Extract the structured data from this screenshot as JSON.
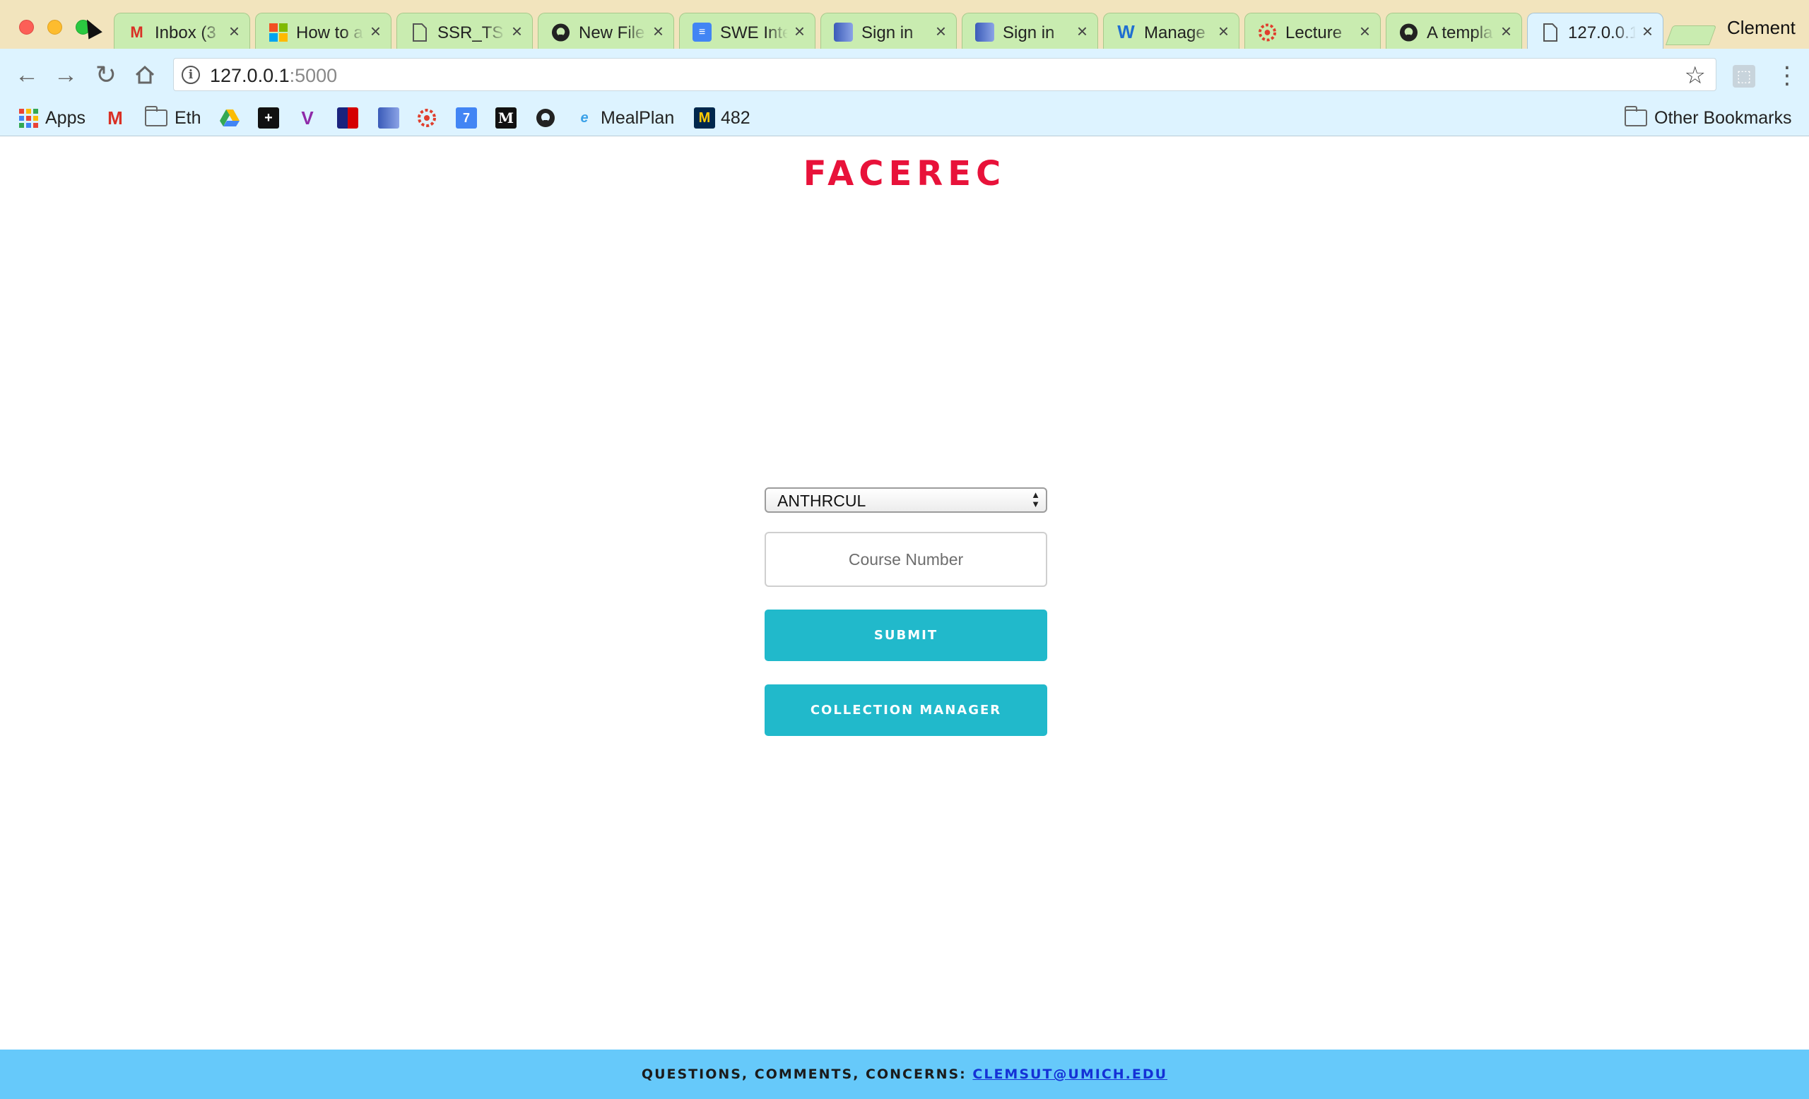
{
  "browser": {
    "profile_name": "Clement",
    "tabs": [
      {
        "title": "Inbox (3",
        "icon": "gmail-icon"
      },
      {
        "title": "How to a",
        "icon": "microsoft-icon"
      },
      {
        "title": "SSR_TSI",
        "icon": "page-icon"
      },
      {
        "title": "New File",
        "icon": "github-icon"
      },
      {
        "title": "SWE Inte",
        "icon": "docs-icon"
      },
      {
        "title": "Sign in",
        "icon": "blue-square-icon"
      },
      {
        "title": "Sign in",
        "icon": "blue-square-icon"
      },
      {
        "title": "Manage",
        "icon": "workday-icon"
      },
      {
        "title": "Lecture",
        "icon": "canvas-icon"
      },
      {
        "title": "A templa",
        "icon": "github-icon"
      },
      {
        "title": "127.0.0.1",
        "icon": "page-icon",
        "active": true
      }
    ],
    "address": {
      "host": "127.0.0.1",
      "port": ":5000"
    },
    "bookmarks": {
      "apps": "Apps",
      "eth": "Eth",
      "mealplan": "MealPlan",
      "n482": "482",
      "other": "Other Bookmarks"
    }
  },
  "page": {
    "brand": "FACEREC",
    "subject_select": {
      "selected": "ANTHRCUL"
    },
    "course_input": {
      "placeholder": "Course Number"
    },
    "submit_label": "SUBMIT",
    "collection_manager_label": "COLLECTION MANAGER",
    "footer": {
      "text": "QUESTIONS, COMMENTS, CONCERNS:",
      "email": "CLEMSUT@UMICH.EDU"
    }
  },
  "colors": {
    "brand": "#e8123a",
    "button": "#21b9cb",
    "footer": "#66c9fa",
    "tab_inactive": "#c9ecb0",
    "tab_active": "#ddf3ff"
  }
}
